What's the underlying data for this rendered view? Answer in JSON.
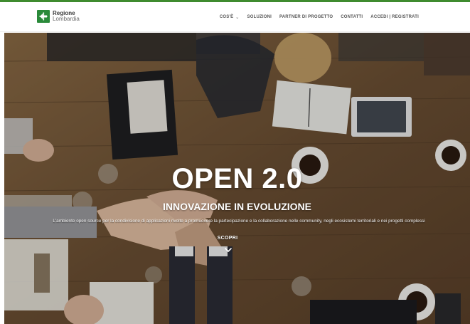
{
  "brand": {
    "logo_line1": "Regione",
    "logo_line2": "Lombardia",
    "color": "#2a8a3a"
  },
  "nav": {
    "items": [
      {
        "label": "COS'È",
        "has_dropdown": true
      },
      {
        "label": "SOLUZIONI"
      },
      {
        "label": "PARTNER DI PROGETTO"
      },
      {
        "label": "CONTATTI"
      },
      {
        "label": "ACCEDI | REGISTRATI"
      }
    ]
  },
  "hero": {
    "title": "OPEN 2.0",
    "subtitle": "INNOVAZIONE IN EVOLUZIONE",
    "description": "L'ambiente open source per la condivisione di applicazioni rivolte a promuovere la partecipazione e la collaborazione nelle community, negli ecosistemi territoriali e nei progetti complessi",
    "cta_label": "SCOPRI",
    "cta_icon": "chevron-down-icon"
  }
}
